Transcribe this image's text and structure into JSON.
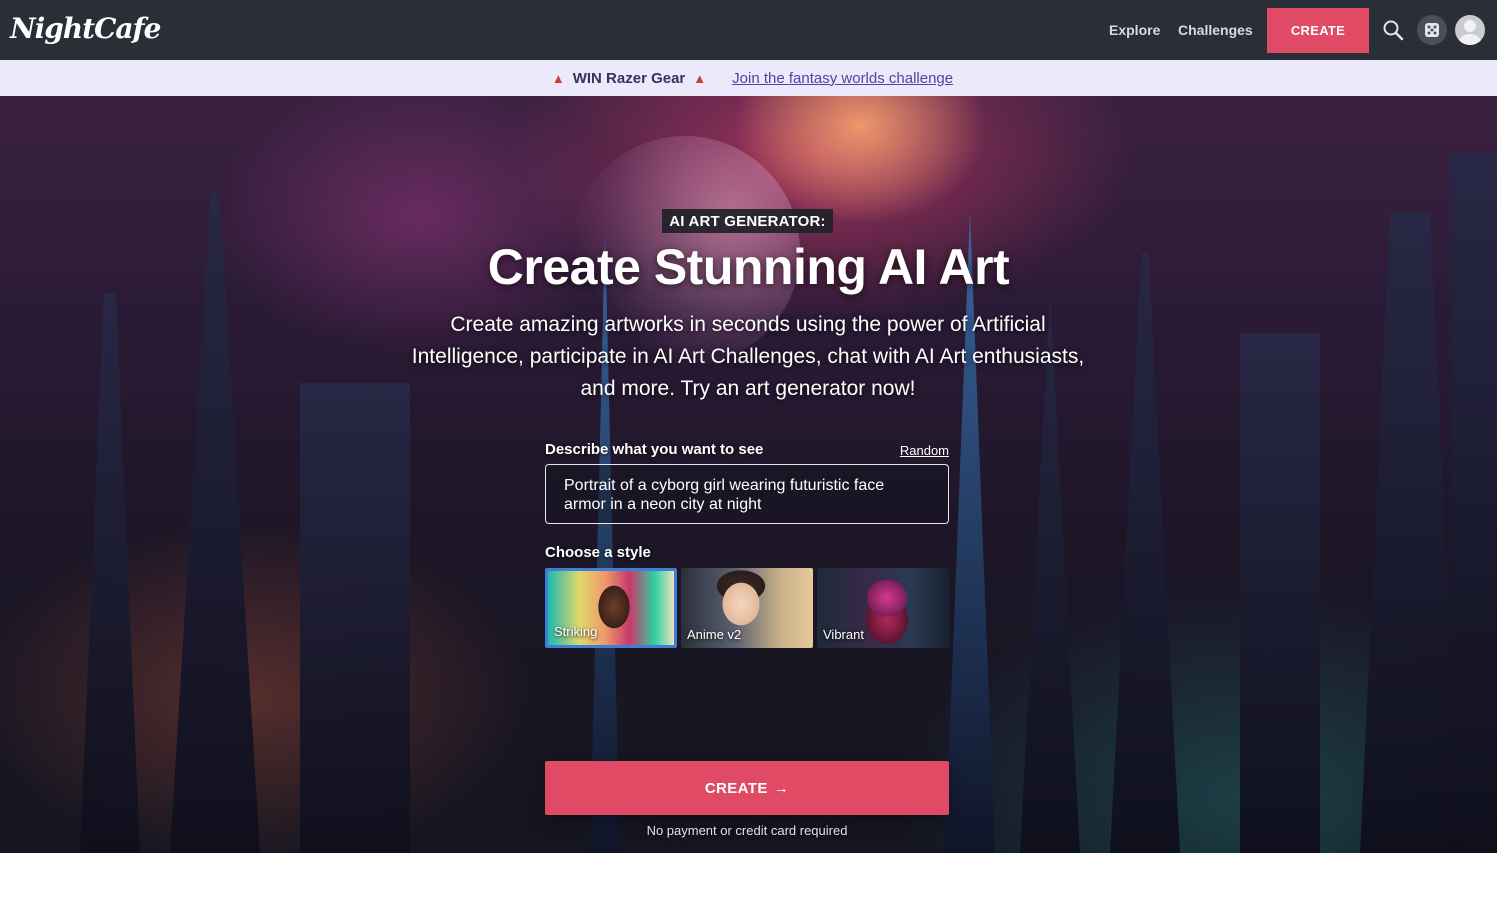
{
  "nav": {
    "logo": "NightCafe",
    "explore": "Explore",
    "challenges": "Challenges",
    "create": "CREATE"
  },
  "promo": {
    "win": "WIN Razer Gear",
    "join": "Join the fantasy worlds challenge"
  },
  "hero": {
    "badge": "AI ART GENERATOR:",
    "headline": "Create Stunning AI Art",
    "subtext": "Create amazing artworks in seconds using the power of Artificial Intelligence, participate in AI Art Challenges, chat with AI Art enthusiasts, and more. Try an art generator now!"
  },
  "form": {
    "describe_label": "Describe what you want to see",
    "random_label": "Random",
    "prompt_value": "Portrait of a cyborg girl wearing futuristic face armor in a neon city at night",
    "style_label": "Choose a style",
    "styles": [
      {
        "name": "Striking",
        "selected": true
      },
      {
        "name": "Anime v2",
        "selected": false
      },
      {
        "name": "Vibrant",
        "selected": false
      }
    ],
    "create_button": "CREATE",
    "no_payment": "No payment or credit card required"
  },
  "colors": {
    "accent": "#e04a64",
    "nav_bg": "#2a2e37",
    "promo_bg": "#ece9fb",
    "selected_border": "#3d7fd6"
  }
}
